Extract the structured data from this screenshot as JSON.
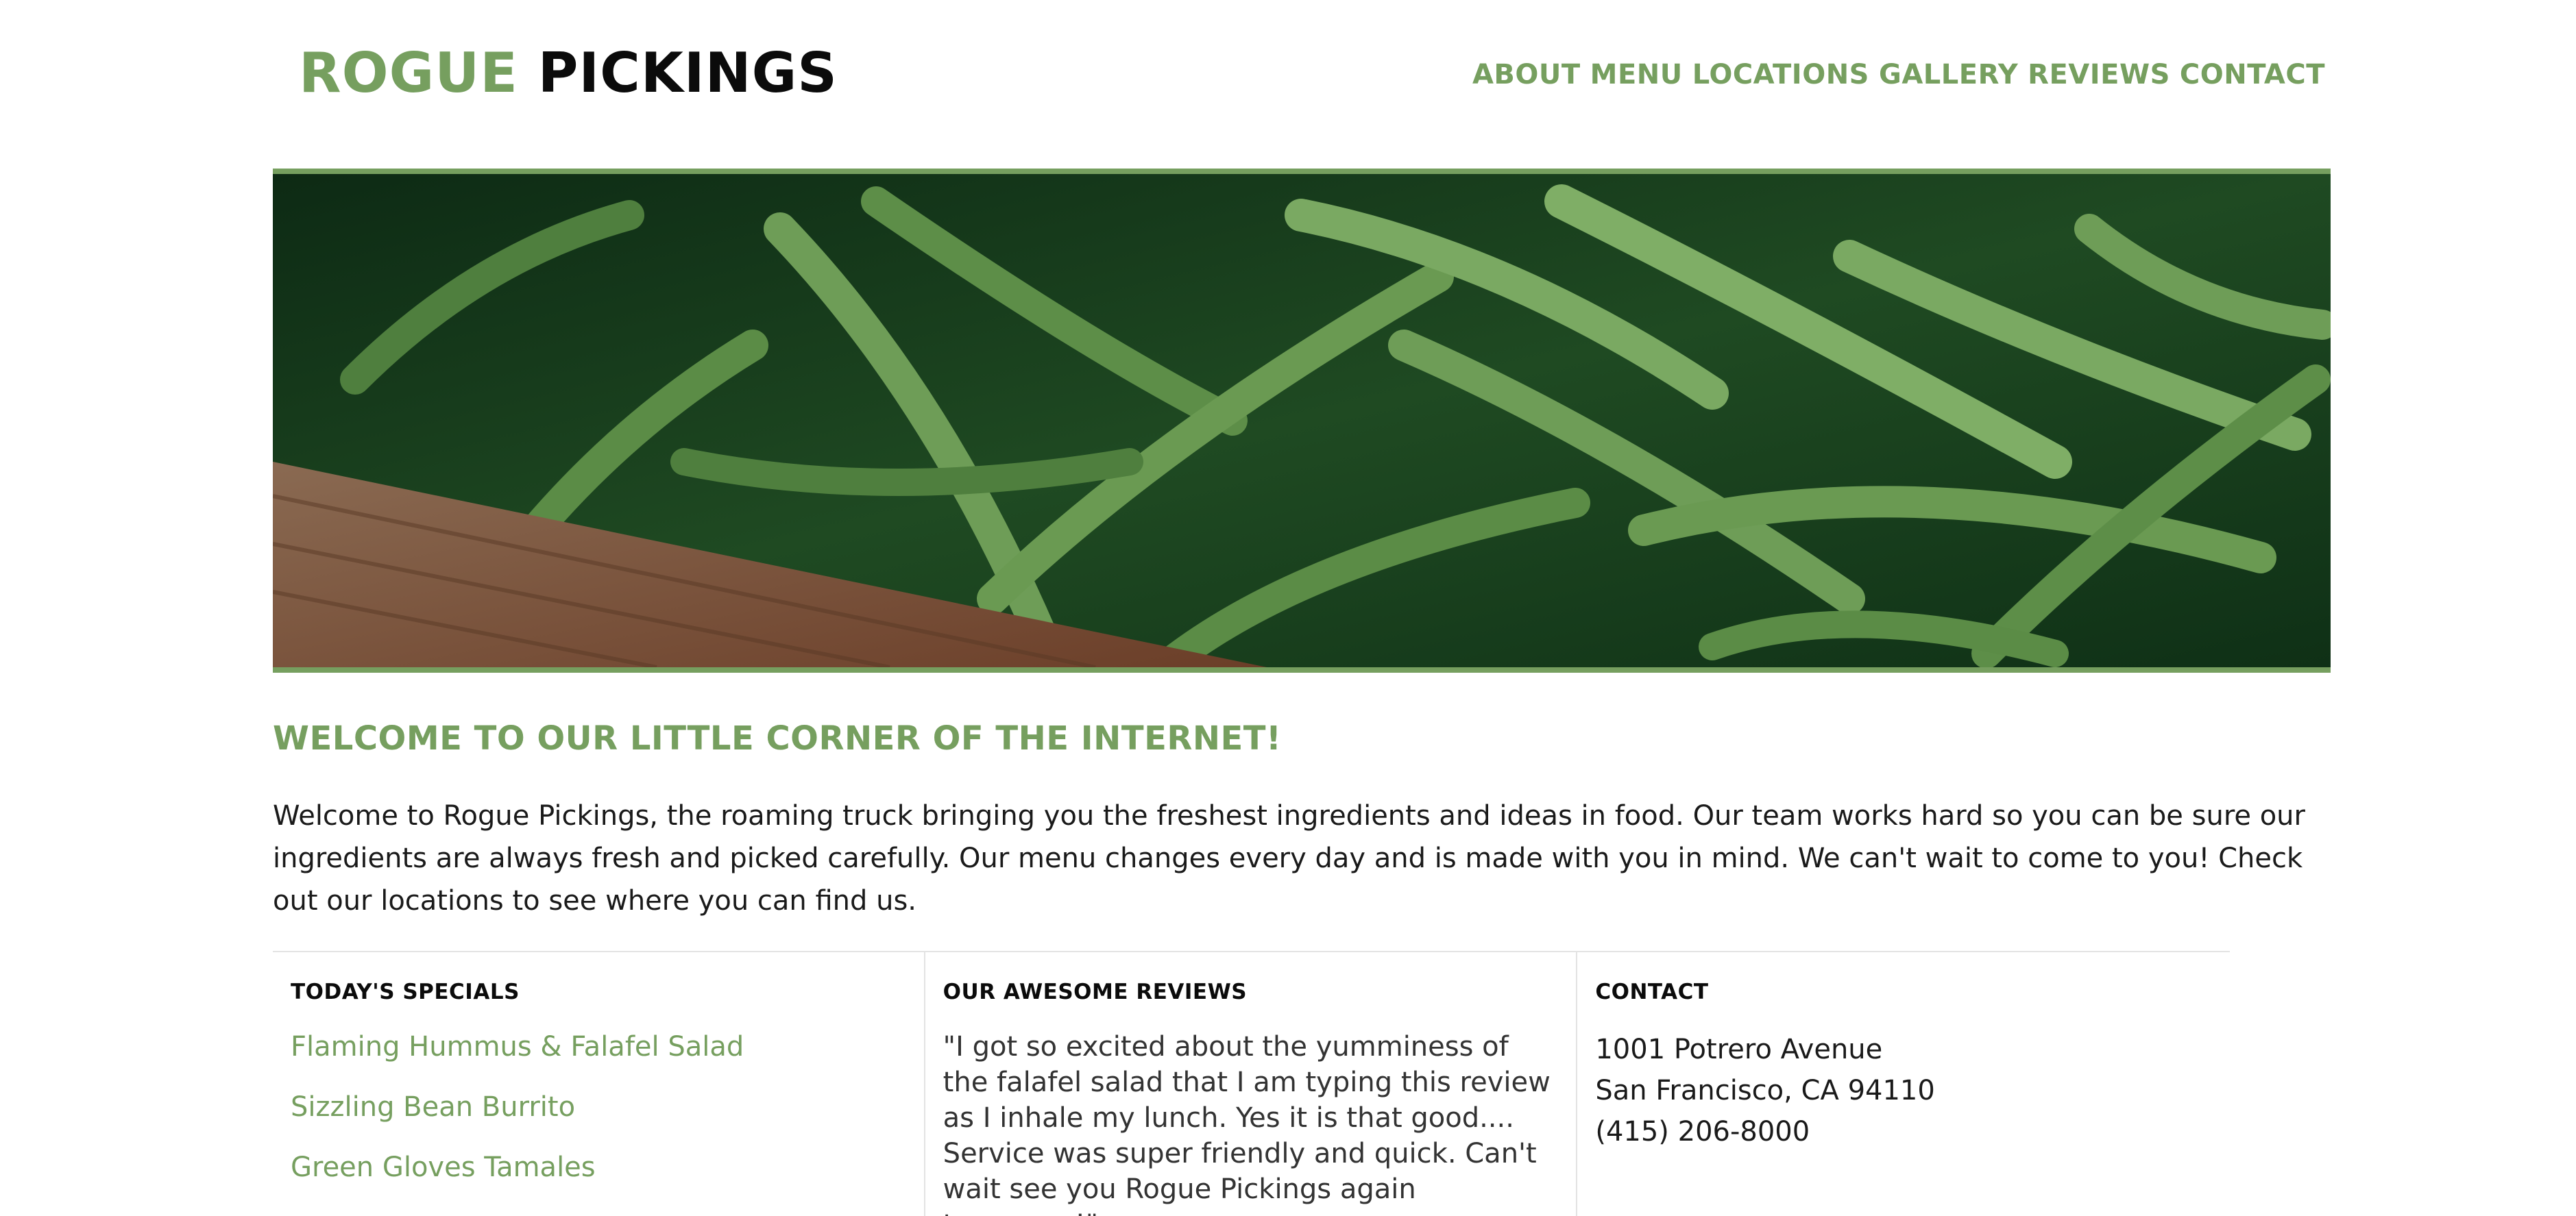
{
  "brand": {
    "part1": "ROGUE",
    "part2": "PICKINGS",
    "accent_color": "#769f5f"
  },
  "nav": {
    "items": [
      {
        "label": "ABOUT"
      },
      {
        "label": "MENU"
      },
      {
        "label": "LOCATIONS"
      },
      {
        "label": "GALLERY"
      },
      {
        "label": "REVIEWS"
      },
      {
        "label": "CONTACT"
      }
    ]
  },
  "hero": {
    "image": "green-beans-in-wooden-crate"
  },
  "welcome": {
    "heading": "WELCOME TO OUR LITTLE CORNER OF THE INTERNET!",
    "text": "Welcome to Rogue Pickings, the roaming truck bringing you the freshest ingredients and ideas in food. Our team works hard so you can be sure our ingredients are always fresh and picked carefully. Our menu changes every day and is made with you in mind. We can't wait to come to you! Check out our locations to see where you can find us."
  },
  "specials": {
    "heading": "TODAY'S SPECIALS",
    "items": [
      {
        "label": "Flaming Hummus & Falafel Salad"
      },
      {
        "label": "Sizzling Bean Burrito"
      },
      {
        "label": "Green Gloves Tamales"
      }
    ]
  },
  "reviews": {
    "heading": "OUR AWESOME REVIEWS",
    "quote": "\"I got so excited about the yumminess of the falafel salad that I am typing this review as I inhale my lunch. Yes it is that good.... Service was super friendly and quick. Can't wait see you Rogue Pickings again tomorrow!\""
  },
  "contact": {
    "heading": "CONTACT",
    "address_line1": "1001 Potrero Avenue",
    "address_line2": "San Francisco, CA 94110",
    "phone": "(415) 206-8000"
  }
}
